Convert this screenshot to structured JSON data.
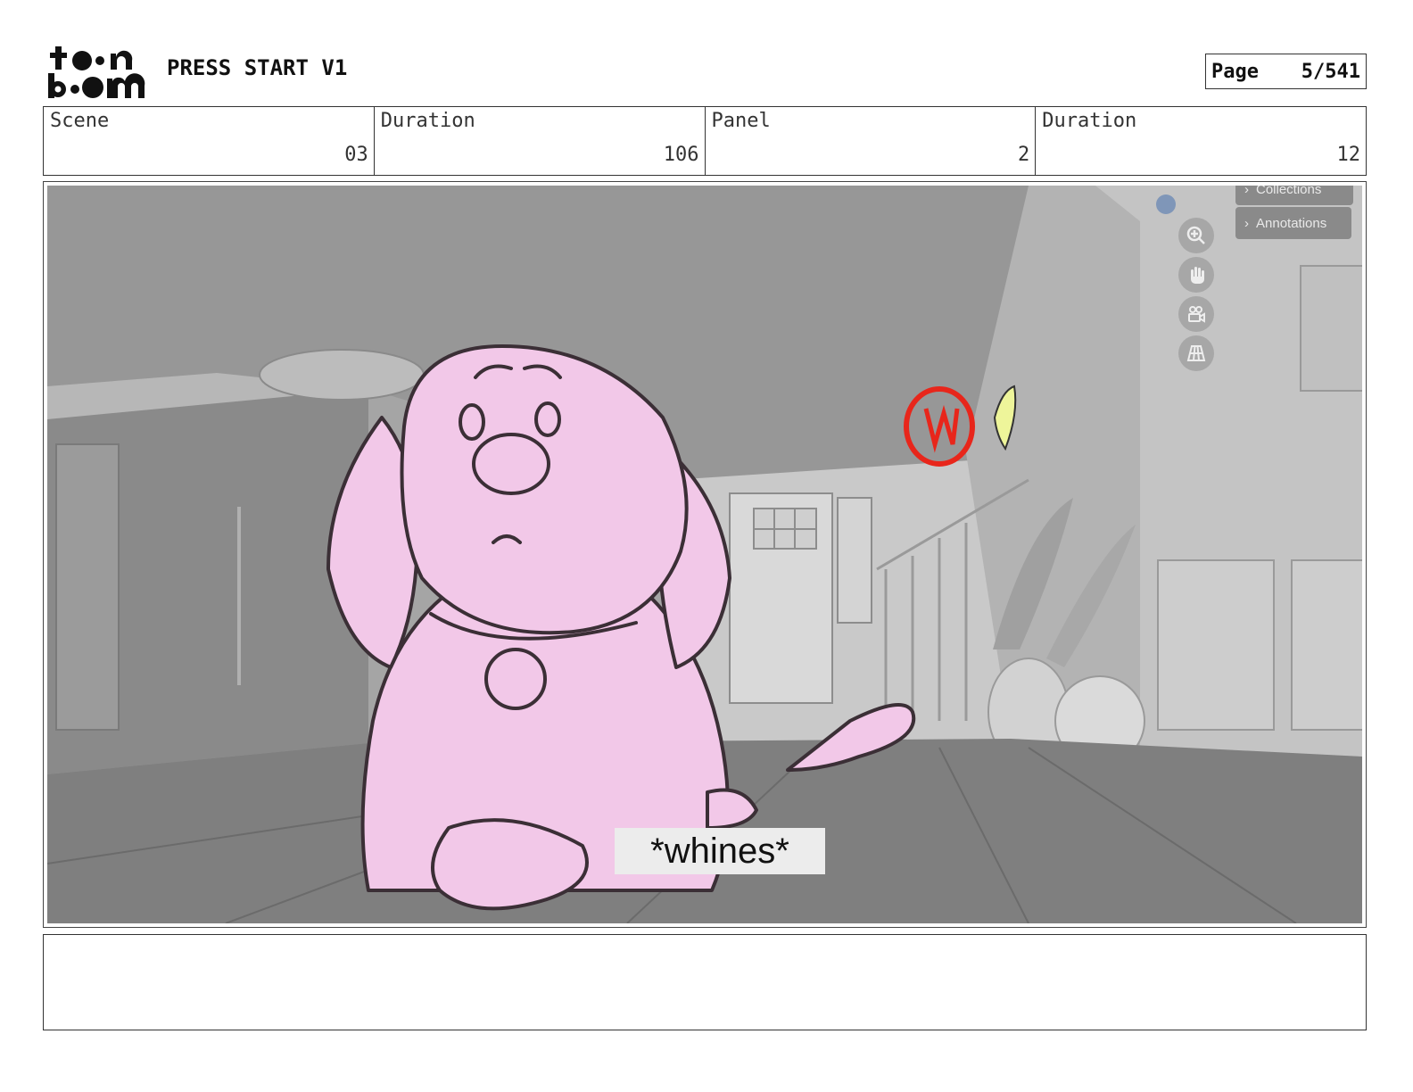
{
  "header": {
    "project_title": "PRESS START V1",
    "page_label": "Page",
    "page_value": "5/541"
  },
  "info": {
    "scene_label": "Scene",
    "scene_value": "03",
    "scene_duration_label": "Duration",
    "scene_duration_value": "106",
    "panel_label": "Panel",
    "panel_value": "2",
    "panel_duration_label": "Duration",
    "panel_duration_value": "12"
  },
  "panel_image": {
    "caption": "*whines*",
    "viewer_ui": {
      "collections_label": "Collections",
      "annotations_label": "Annotations",
      "tools": [
        "zoom-in-icon",
        "hand-pan-icon",
        "camera-icon",
        "grid-icon"
      ]
    },
    "colors": {
      "character_fill": "#f2c8e8",
      "annotation_mark": "#e8261b",
      "highlight_mark": "#eef59a"
    }
  },
  "notes": {
    "text": ""
  }
}
